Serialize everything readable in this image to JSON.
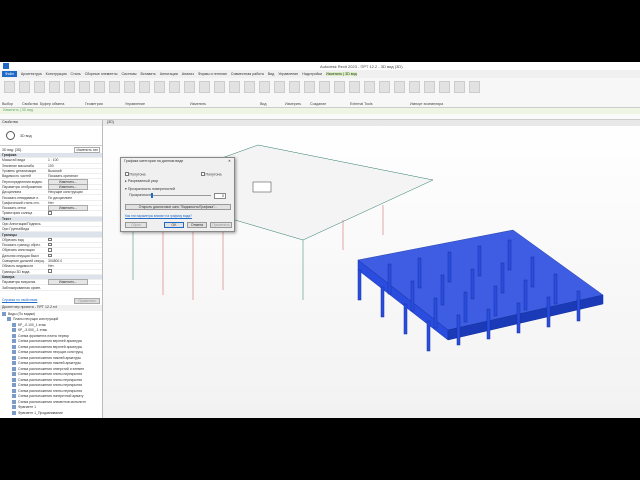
{
  "title": "Autodesk Revit 2023 - ПРТ 12.2 - 3D вид (3D)",
  "tabs": [
    "Файл",
    "Архитектура",
    "Конструкция",
    "Сталь",
    "Сборные элементы",
    "Системы",
    "Вставить",
    "Аннотации",
    "Анализ",
    "Формы и генплан",
    "Совместная работа",
    "Вид",
    "Управление",
    "Надстройки",
    "Изменить | 3D вид"
  ],
  "panels": [
    "Выбор",
    "Свойства",
    "Буфер обмена",
    "Геометрия",
    "Управление",
    "Изменить",
    "Вид",
    "Измерить",
    "Создание",
    "External Tools",
    "Импорт экземпляра"
  ],
  "context_label": "Изменить | 3D вид",
  "properties": {
    "header": "Свойства",
    "type_name": "3D вид",
    "instance": "3D вид: {3D}",
    "edit_type": "Изменить тип",
    "rows": [
      {
        "k": "Графика",
        "v": "",
        "grp": true
      },
      {
        "k": "Масштаб вида",
        "v": "1 : 100"
      },
      {
        "k": "Значение масштаба",
        "v": "100"
      },
      {
        "k": "Уровень детализации",
        "v": "Высокий"
      },
      {
        "k": "Видимость частей",
        "v": "Показать оригинал"
      },
      {
        "k": "Переопределения видим.",
        "v": "Изменить...",
        "btn": true
      },
      {
        "k": "Параметры отображения",
        "v": "Изменить...",
        "btn": true
      },
      {
        "k": "Дисциплина",
        "v": "Несущие конструкции"
      },
      {
        "k": "Показать невидимые л.",
        "v": "По дисциплине"
      },
      {
        "k": "Графический стиль отл.",
        "v": "Нет"
      },
      {
        "k": "Показать сетки",
        "v": "Изменить...",
        "btn": true
      },
      {
        "k": "Траектория солнца",
        "v": "",
        "cb": true
      },
      {
        "k": "Текст",
        "v": "",
        "grp": true
      },
      {
        "k": "Ори Аннотации/Подпись",
        "v": ""
      },
      {
        "k": "Ори Группа/Вида",
        "v": ""
      },
      {
        "k": "Границы",
        "v": "",
        "grp": true
      },
      {
        "k": "Обрезать вид",
        "v": "",
        "cb": true
      },
      {
        "k": "Показать границу обрез.",
        "v": "",
        "cb": true
      },
      {
        "k": "Обрезать аннотации",
        "v": "",
        "cb": true
      },
      {
        "k": "Дальняя секущая Выкл",
        "v": "",
        "cb": true
      },
      {
        "k": "Смещение дальней секущ.",
        "v": "304800.0"
      },
      {
        "k": "Область видимости",
        "v": "Нет"
      },
      {
        "k": "Границы 3D вида",
        "v": "",
        "cb": true
      },
      {
        "k": "Камера",
        "v": "",
        "grp": true
      },
      {
        "k": "Параметры визуализ.",
        "v": "Изменить...",
        "btn": true
      },
      {
        "k": "Заблокированная ориен.",
        "v": ""
      }
    ],
    "help_link": "Справка по свойствам",
    "apply": "Применить"
  },
  "browser": {
    "header": "Диспетчер проекта - ПРТ 12.2.rvt",
    "items": [
      {
        "t": "Виды (По видам)",
        "lvl": 0
      },
      {
        "t": "Планы несущих конструкций",
        "lvl": 1
      },
      {
        "t": "КР_-0.100_1 этаж",
        "lvl": 2
      },
      {
        "t": "КР_-3.000_-1 этаж",
        "lvl": 2
      },
      {
        "t": "Схема фрагмента плиты перекр",
        "lvl": 2
      },
      {
        "t": "Схема расположения верхней арматуры",
        "lvl": 2
      },
      {
        "t": "Схема расположения верхней арматуры",
        "lvl": 2
      },
      {
        "t": "Схема расположения несущих конструкц",
        "lvl": 2
      },
      {
        "t": "Схема расположения нижней арматуры",
        "lvl": 2
      },
      {
        "t": "Схема расположения нижней арматуры",
        "lvl": 2
      },
      {
        "t": "Схема расположения отверстий и элемен",
        "lvl": 2
      },
      {
        "t": "Схема расположения плиты перекрытия",
        "lvl": 2
      },
      {
        "t": "Схема расположения плиты перекрытия",
        "lvl": 2
      },
      {
        "t": "Схема расположения плиты перекрытия",
        "lvl": 2
      },
      {
        "t": "Схема расположения плиты перекрытия",
        "lvl": 2
      },
      {
        "t": "Схема расположения поперечной армату",
        "lvl": 2
      },
      {
        "t": "Схема расположения элементов монолитн",
        "lvl": 2
      },
      {
        "t": "Фрагмент 1",
        "lvl": 2
      },
      {
        "t": "Фрагмент 1_Продавливание",
        "lvl": 2
      }
    ]
  },
  "view_tab": "{3D}",
  "dialog": {
    "title": "Графика категории на данном виде",
    "halftone": "Полутона",
    "surface_patterns": "Разрезанный узор",
    "opaque": "Полутона",
    "transparency_label": "Прозрачность поверхностей",
    "transparency": "Прозрачность:",
    "transparency_value": "0",
    "vg_button": "Открыть диалоговое окно \"Видимость/Графика\"...",
    "link": "Как эти параметры влияют на графику вида?",
    "reset": "Сброс",
    "ok": "OK",
    "cancel": "Отмена",
    "apply": "Применить"
  },
  "colors": {
    "model": "#2a4de0",
    "file_tab": "#1e6ac6"
  }
}
